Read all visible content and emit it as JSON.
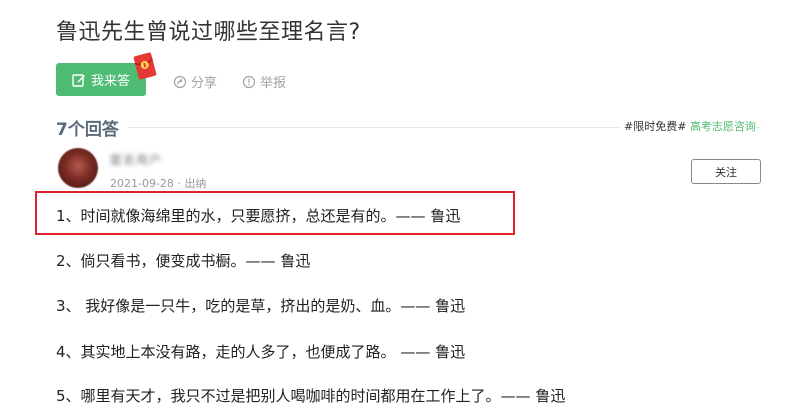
{
  "question": {
    "title": "鲁迅先生曾说过哪些至理名言?"
  },
  "actions": {
    "answer_label": "我来答",
    "share_label": "分享",
    "report_label": "举报"
  },
  "answers_header": {
    "count_label": "7个回答",
    "promo_tag": "#限时免费#",
    "promo_link": "高考志愿咨询"
  },
  "answer": {
    "username": "匿名用户",
    "date": "2021-09-28",
    "separator": " · ",
    "via": "出纳",
    "follow_label": "关注",
    "lines": [
      "1、时间就像海绵里的水，只要愿挤，总还是有的。—— 鲁迅",
      "2、倘只看书，便变成书橱。—— 鲁迅",
      "3、 我好像是一只牛，吃的是草，挤出的是奶、血。—— 鲁迅",
      "4、其实地上本没有路，走的人多了，也便成了路。 —— 鲁迅",
      "5、哪里有天才，我只不过是把别人喝咖啡的时间都用在工作上了。—— 鲁迅"
    ]
  },
  "colors": {
    "accent": "#4fbc73",
    "highlight": "#e3222b"
  }
}
